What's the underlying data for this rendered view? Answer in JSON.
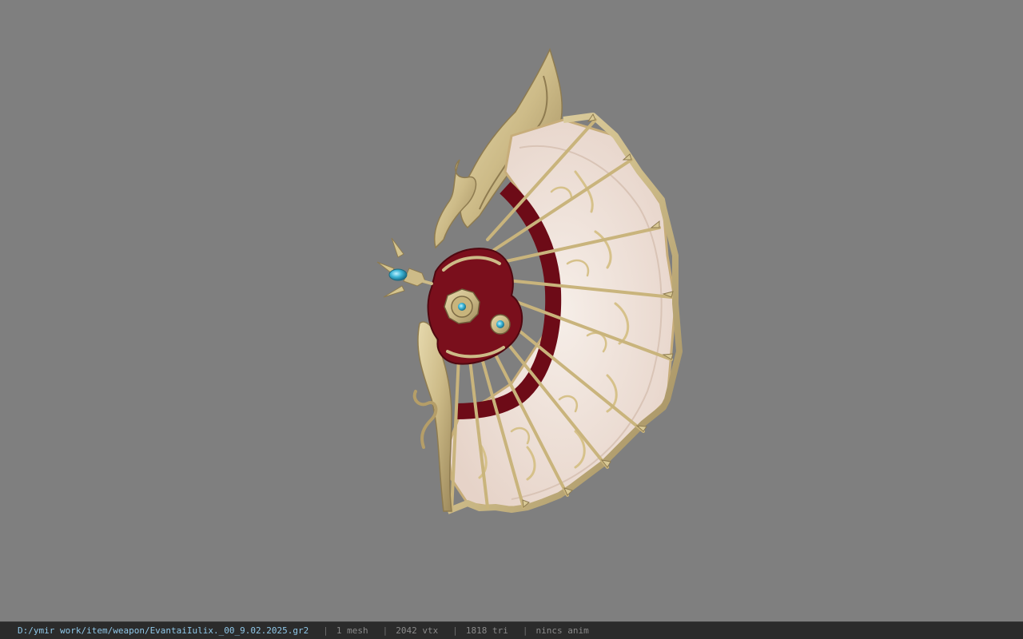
{
  "viewport": {
    "background_color": "#7f7f7f",
    "model": {
      "kind": "3d-fan-weapon",
      "colors": {
        "gold": "#cdbb88",
        "gold_dark": "#9e8a5c",
        "gold_light": "#e6d9ad",
        "crimson": "#7a0f1c",
        "crimson_dark": "#5a0912",
        "paper": "#efe3dc",
        "paper_edge": "#d9c4b6",
        "gem": "#3fb7d8"
      }
    }
  },
  "status_bar": {
    "file_path": "D:/ymir work/item/weapon/EvantaiIulix._00_9.02.2025.gr2",
    "separator": "|",
    "mesh_count": "1 mesh",
    "vertex_count": "2042 vtx",
    "triangle_count": "1818 tri",
    "anim_status": "nincs anim"
  }
}
